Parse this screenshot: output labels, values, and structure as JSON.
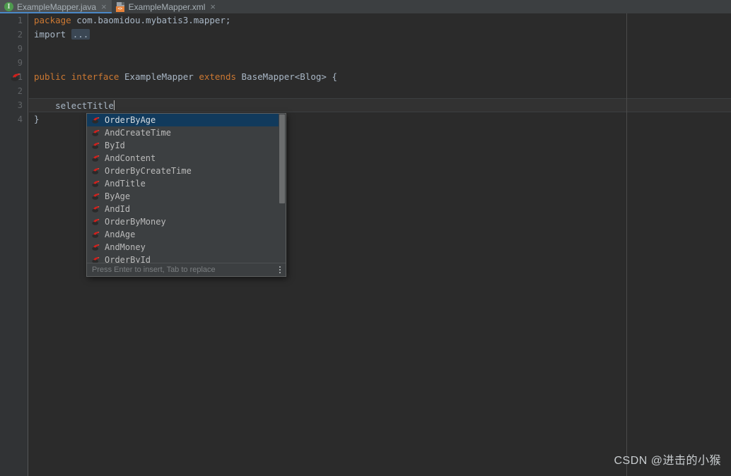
{
  "window": {
    "theme": "Darcula",
    "background_color": "#2B2B2B",
    "accent_color": "#4A88C7"
  },
  "tabs": [
    {
      "label": "ExampleMapper.java",
      "icon": "java-interface-icon",
      "icon_glyph": "I",
      "active": true,
      "close_label": "×"
    },
    {
      "label": "ExampleMapper.xml",
      "icon": "xml-file-icon",
      "icon_glyph": "<>",
      "active": false,
      "close_label": "×"
    }
  ],
  "editor": {
    "line_numbers": [
      "1",
      "2",
      "9",
      "9",
      "1",
      "2",
      "3",
      "4"
    ],
    "fold_marker_glyph": "+",
    "gutter_icon": "mybatis-navigate-icon",
    "lines": [
      {
        "num": "1",
        "segments": [
          {
            "text": "package",
            "cls": "kw"
          },
          {
            "text": " com.baomidou.mybatis3.mapper;",
            "cls": "plain"
          }
        ]
      },
      {
        "num": "2",
        "segments": [
          {
            "text": "import",
            "cls": "plain"
          },
          {
            "text": " ",
            "cls": "plain"
          },
          {
            "text": "...",
            "cls": "folded"
          }
        ]
      },
      {
        "num": "9",
        "segments": []
      },
      {
        "num": "9",
        "segments": []
      },
      {
        "num": "1",
        "segments": [
          {
            "text": "public",
            "cls": "kw"
          },
          {
            "text": " ",
            "cls": "plain"
          },
          {
            "text": "interface",
            "cls": "kw"
          },
          {
            "text": " ExampleMapper ",
            "cls": "plain"
          },
          {
            "text": "extends",
            "cls": "kw"
          },
          {
            "text": " BaseMapper<Blog> {",
            "cls": "plain"
          }
        ]
      },
      {
        "num": "2",
        "segments": []
      },
      {
        "num": "3",
        "segments": [
          {
            "text": "    selectTitle",
            "cls": "plain"
          }
        ]
      },
      {
        "num": "4",
        "segments": [
          {
            "text": "}",
            "cls": "plain"
          }
        ]
      }
    ],
    "caret_text": "selectTitle",
    "caret_line_index": 6
  },
  "completion_popup": {
    "selected_index": 0,
    "item_icon": "mybatis-bird-icon",
    "items": [
      {
        "label": "OrderByAge"
      },
      {
        "label": "AndCreateTime"
      },
      {
        "label": "ById"
      },
      {
        "label": "AndContent"
      },
      {
        "label": "OrderByCreateTime"
      },
      {
        "label": "AndTitle"
      },
      {
        "label": "ByAge"
      },
      {
        "label": "AndId"
      },
      {
        "label": "OrderByMoney"
      },
      {
        "label": "AndAge"
      },
      {
        "label": "AndMoney"
      },
      {
        "label": "OrderById"
      }
    ],
    "footer_hint": "Press Enter to insert, Tab to replace",
    "menu_icon": "kebab-menu-icon"
  },
  "watermark": {
    "text": "CSDN @进击的小猴"
  }
}
